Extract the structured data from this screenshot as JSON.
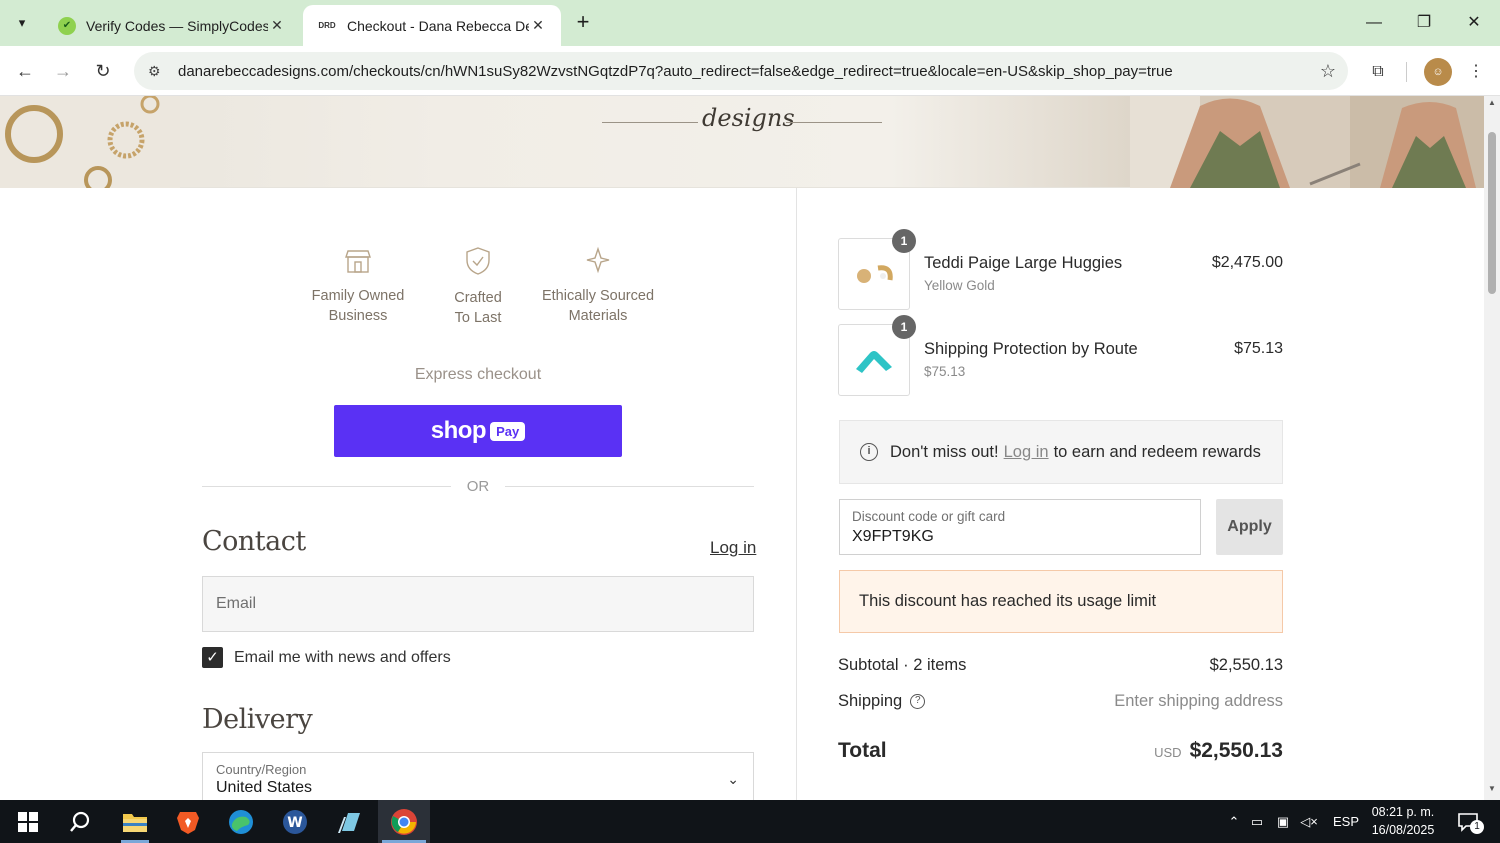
{
  "browser": {
    "tabs": [
      {
        "title": "Verify Codes — SimplyCodes",
        "active": false
      },
      {
        "title": "Checkout - Dana Rebecca Designs",
        "favicon_text": "DRD",
        "active": true
      }
    ],
    "url": "danarebeccadesigns.com/checkouts/cn/hWN1suSy82WzvstNGqtzdP7q?auto_redirect=false&edge_redirect=true&locale=en-US&skip_shop_pay=true"
  },
  "banner": {
    "logo_text": "designs"
  },
  "badges": [
    {
      "label_line1": "Family Owned",
      "label_line2": "Business",
      "icon": "storefront-icon"
    },
    {
      "label_line1": "Crafted",
      "label_line2": "To Last",
      "icon": "shield-check-icon"
    },
    {
      "label_line1": "Ethically Sourced",
      "label_line2": "Materials",
      "icon": "sparkle-icon"
    }
  ],
  "express": {
    "label": "Express checkout",
    "shop_label": "shop",
    "pay_label": "Pay",
    "or_label": "OR"
  },
  "contact": {
    "title": "Contact",
    "login_label": "Log in",
    "email_placeholder": "Email",
    "newsletter_label": "Email me with news and offers",
    "newsletter_checked": true
  },
  "delivery": {
    "title": "Delivery",
    "country_label": "Country/Region",
    "country_value": "United States"
  },
  "cart": {
    "items": [
      {
        "qty": "1",
        "name": "Teddi Paige Large Huggies",
        "variant": "Yellow Gold",
        "price": "$2,475.00"
      },
      {
        "qty": "1",
        "name": "Shipping Protection by Route",
        "variant": "$75.13",
        "price": "$75.13"
      }
    ],
    "rewards": {
      "prefix": "Don't miss out!",
      "link": "Log in",
      "suffix": "to earn and redeem rewards"
    },
    "discount": {
      "label": "Discount code or gift card",
      "value": "X9FPT9KG",
      "apply_label": "Apply"
    },
    "error": "This discount has reached its usage limit",
    "subtotal_label": "Subtotal · 2 items",
    "subtotal_value": "$2,550.13",
    "shipping_label": "Shipping",
    "shipping_value": "Enter shipping address",
    "total_label": "Total",
    "total_currency": "USD",
    "total_value": "$2,550.13"
  },
  "taskbar": {
    "language": "ESP",
    "time": "08:21 p. m.",
    "date": "16/08/2025",
    "notifications": "1"
  }
}
